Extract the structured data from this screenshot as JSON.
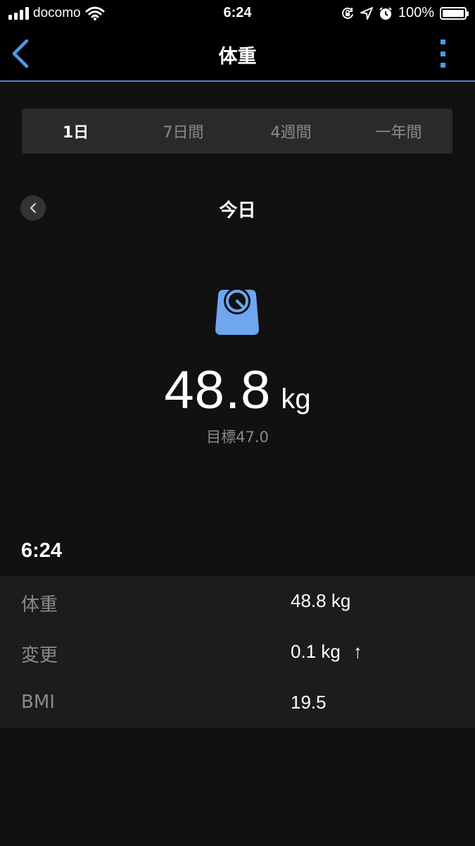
{
  "status_bar": {
    "carrier": "docomo",
    "time": "6:24",
    "battery_percent": "100%",
    "battery_level": 1.0,
    "icons": [
      "signal-icon",
      "wifi-icon",
      "orientation-lock-icon",
      "location-icon",
      "alarm-icon",
      "battery-icon"
    ]
  },
  "nav": {
    "title": "体重",
    "back_icon": "chevron-left-icon",
    "menu_icon": "more-vertical-icon",
    "accent_color": "#4a9be8"
  },
  "tabs": [
    {
      "label": "1日",
      "active": true
    },
    {
      "label": "7日間",
      "active": false
    },
    {
      "label": "4週間",
      "active": false
    },
    {
      "label": "一年間",
      "active": false
    }
  ],
  "date": {
    "label": "今日",
    "prev_icon": "chevron-left-icon"
  },
  "summary": {
    "icon": "scale-icon",
    "icon_color": "#6ea6f0",
    "weight": "48.8",
    "unit": "kg",
    "goal": "目標47.0"
  },
  "entry": {
    "time": "6:24",
    "rows": [
      {
        "label": "体重",
        "value": "48.8 kg"
      },
      {
        "label": "変更",
        "value": "0.1 kg",
        "trend_icon": "arrow-up-icon"
      },
      {
        "label": "BMI",
        "value": "19.5"
      }
    ]
  }
}
